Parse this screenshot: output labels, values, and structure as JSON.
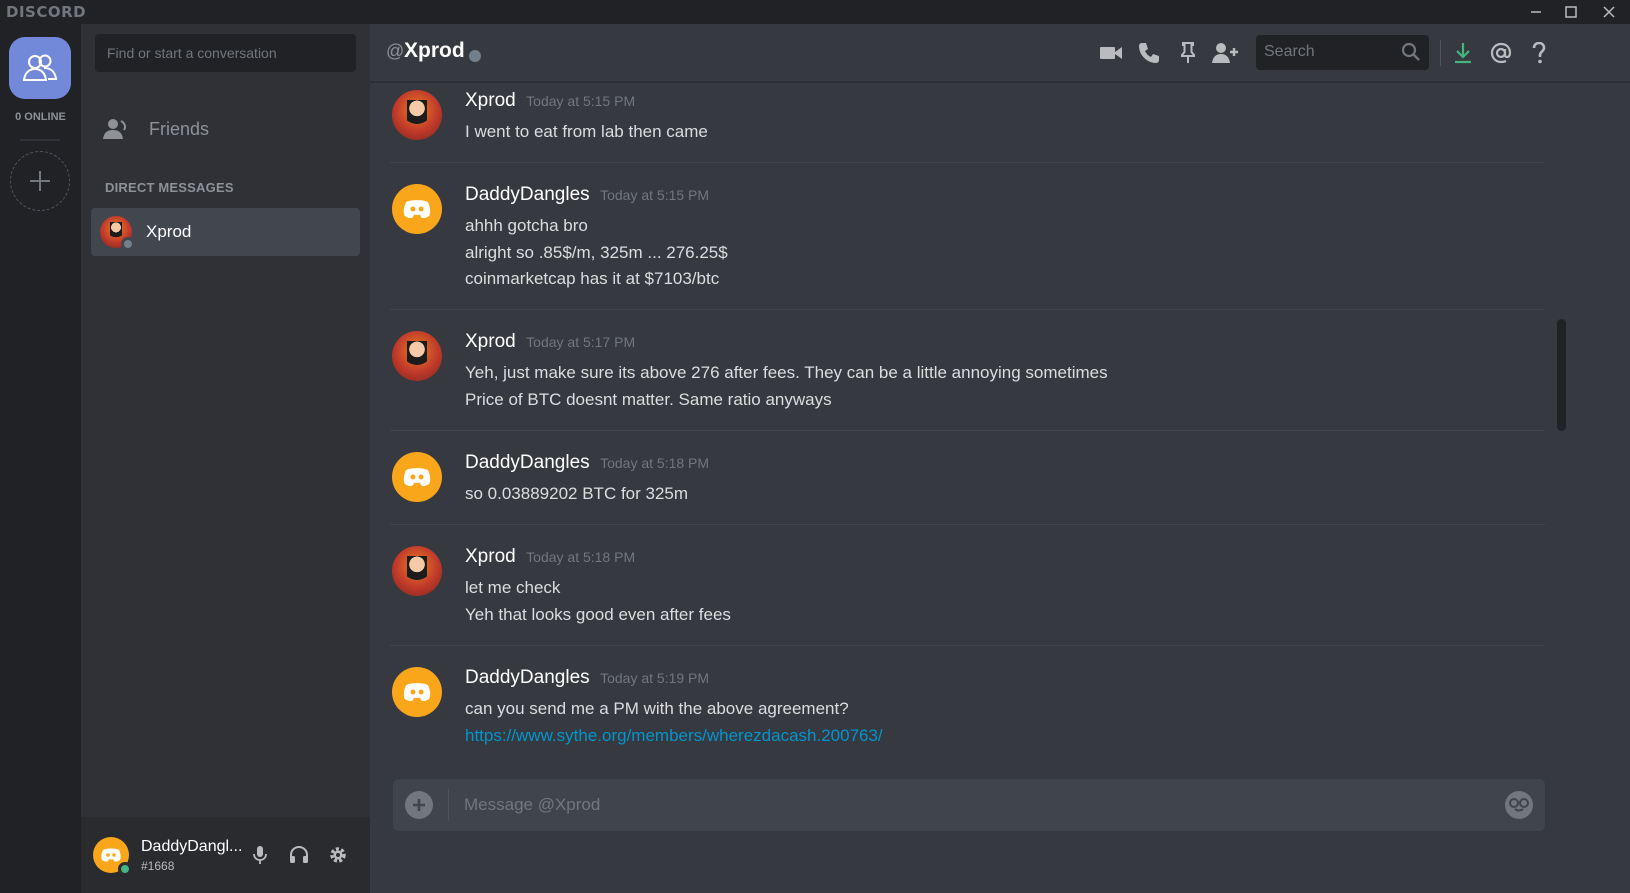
{
  "app": {
    "logo": "DISCORD"
  },
  "rail": {
    "online_label": "0 ONLINE"
  },
  "sidebar": {
    "search_placeholder": "Find or start a conversation",
    "friends_label": "Friends",
    "dm_header": "DIRECT MESSAGES",
    "dms": [
      {
        "name": "Xprod",
        "status": "offline"
      }
    ]
  },
  "user_panel": {
    "name": "DaddyDangl...",
    "tag": "#1668",
    "status_color": "#43b581"
  },
  "chat": {
    "at_symbol": "@",
    "recipient": "Xprod",
    "search_placeholder": "Search",
    "composer_placeholder": "Message @Xprod",
    "messages": [
      {
        "author": "Xprod",
        "time": "Today at 5:15 PM",
        "lines": [
          "I went to eat from lab then came"
        ]
      },
      {
        "author": "DaddyDangles",
        "time": "Today at 5:15 PM",
        "lines": [
          "ahhh gotcha bro",
          "alright so .85$/m, 325m ... 276.25$",
          "coinmarketcap has it at $7103/btc"
        ]
      },
      {
        "author": "Xprod",
        "time": "Today at 5:17 PM",
        "lines": [
          "Yeh, just make sure its above 276 after fees. They can be a little annoying sometimes",
          "Price of BTC doesnt matter. Same ratio anyways"
        ]
      },
      {
        "author": "DaddyDangles",
        "time": "Today at 5:18 PM",
        "lines": [
          "so 0.03889202 BTC for 325m"
        ]
      },
      {
        "author": "Xprod",
        "time": "Today at 5:18 PM",
        "lines": [
          "let me check",
          "Yeh that looks good even after fees"
        ]
      },
      {
        "author": "DaddyDangles",
        "time": "Today at 5:19 PM",
        "lines": [
          "can you send me a PM with the above agreement?"
        ],
        "link": "https://www.sythe.org/members/wherezdacash.200763/"
      }
    ]
  },
  "colors": {
    "accent": "#7289da",
    "link": "#0096cf",
    "download": "#43b581"
  }
}
